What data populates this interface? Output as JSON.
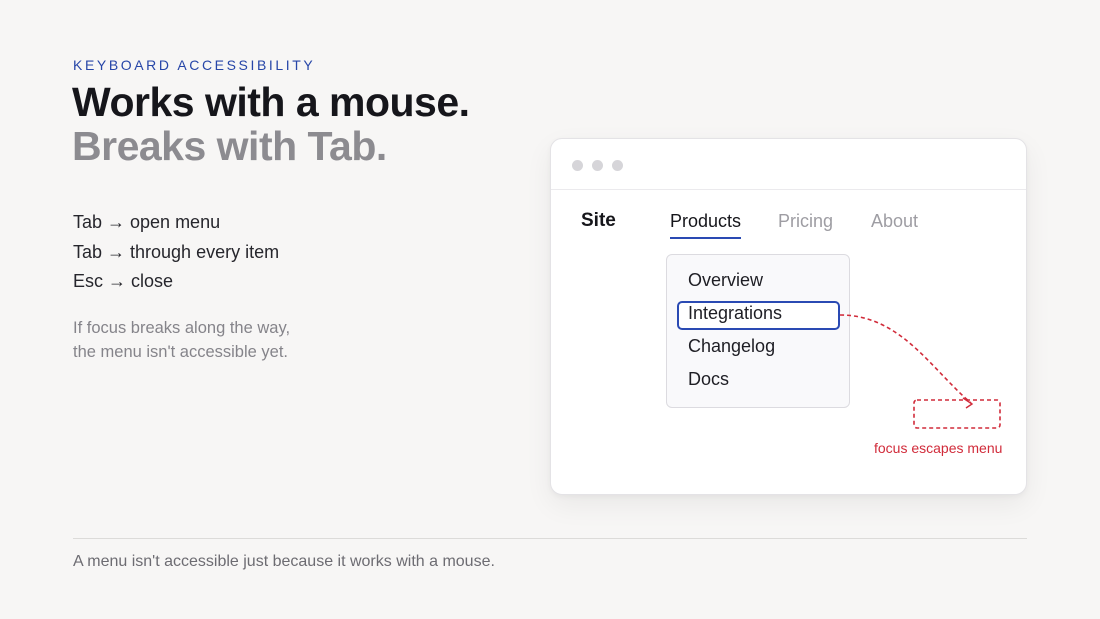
{
  "eyebrow": "KEYBOARD ACCESSIBILITY",
  "headline": "Works with a mouse.",
  "subhead": "Breaks with Tab.",
  "steps": [
    "Tab → open menu",
    "Tab → through every item",
    "Esc → close"
  ],
  "note": {
    "line1": "If focus breaks along the way,",
    "line2": "the menu isn't accessible yet."
  },
  "footer": "A menu isn't accessible just because it works with a mouse.",
  "mockup": {
    "site_logo": "Site",
    "nav": [
      "Products",
      "Pricing",
      "About"
    ],
    "active_nav": "Products",
    "menu_items": [
      "Overview",
      "Integrations",
      "Changelog",
      "Docs"
    ],
    "focused_item": "Integrations",
    "escape_label": "focus escapes menu"
  },
  "colors": {
    "accent_blue": "#2a4ab3",
    "eyebrow_blue": "#2746a8",
    "error_red": "#d12b3a",
    "background": "#f7f6f5"
  }
}
